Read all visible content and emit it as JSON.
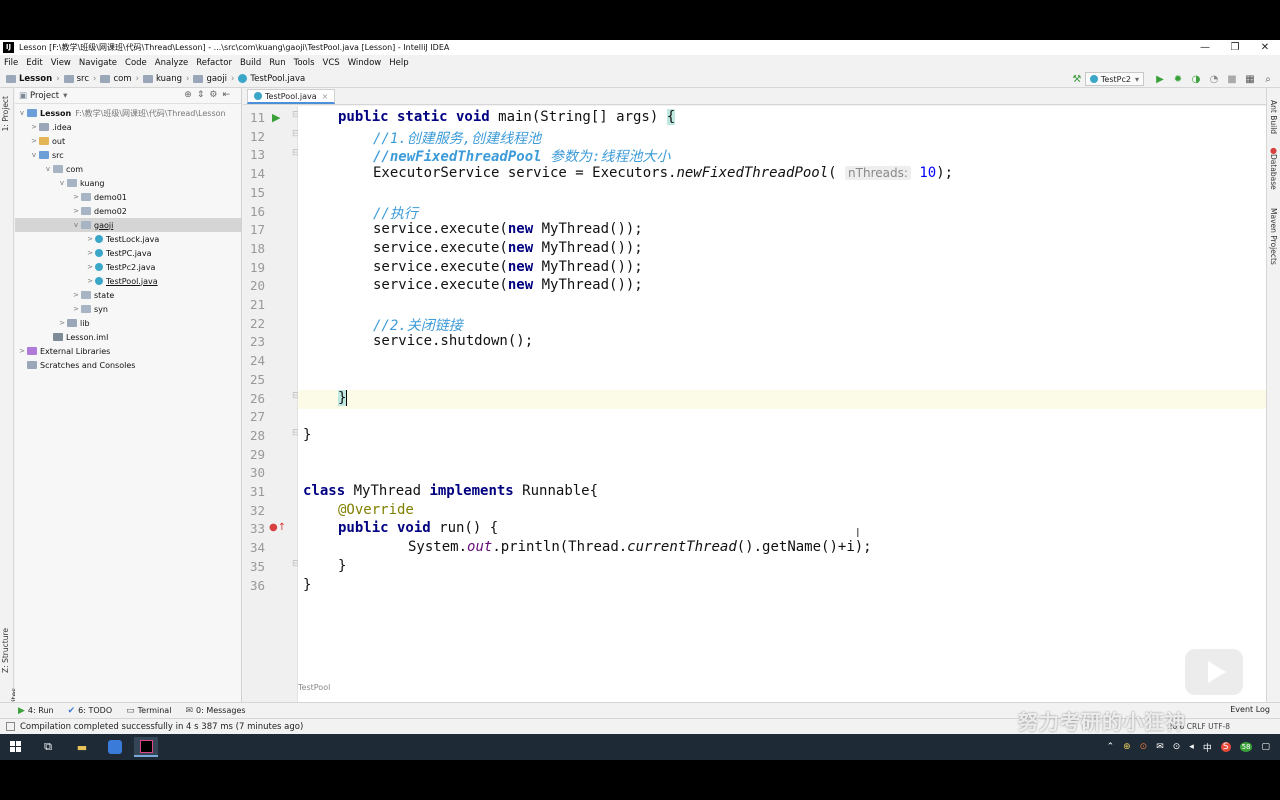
{
  "window": {
    "title": "Lesson [F:\\教学\\班级\\网课班\\代码\\Thread\\Lesson] - ...\\src\\com\\kuang\\gaoji\\TestPool.java [Lesson] - IntelliJ IDEA",
    "controls": [
      "—",
      "❐",
      "✕"
    ]
  },
  "menu": [
    "File",
    "Edit",
    "View",
    "Navigate",
    "Code",
    "Analyze",
    "Refactor",
    "Build",
    "Run",
    "Tools",
    "VCS",
    "Window",
    "Help"
  ],
  "breadcrumbs": [
    "Lesson",
    "src",
    "com",
    "kuang",
    "gaoji",
    "TestPool.java"
  ],
  "run_config": "TestPc2",
  "left_tabs": {
    "project": "1: Project",
    "structure": "Z: Structure",
    "favorites": "2: Favorites"
  },
  "project_panel": {
    "title": "Project",
    "tree": [
      {
        "label": "Lesson",
        "path": "F:\\教学\\班级\\网课班\\代码\\Thread\\Lesson",
        "arrow": "v"
      },
      {
        "label": ".idea",
        "arrow": ">"
      },
      {
        "label": "out",
        "arrow": ">"
      },
      {
        "label": "src",
        "arrow": "v"
      },
      {
        "label": "com",
        "arrow": "v"
      },
      {
        "label": "kuang",
        "arrow": "v"
      },
      {
        "label": "demo01",
        "arrow": ">"
      },
      {
        "label": "demo02",
        "arrow": ">"
      },
      {
        "label": "gaoji",
        "arrow": "v"
      },
      {
        "label": "TestLock.java",
        "arrow": ">"
      },
      {
        "label": "TestPC.java",
        "arrow": ">"
      },
      {
        "label": "TestPc2.java",
        "arrow": ">"
      },
      {
        "label": "TestPool.java",
        "arrow": ">"
      },
      {
        "label": "state",
        "arrow": ">"
      },
      {
        "label": "syn",
        "arrow": ">"
      },
      {
        "label": "lib",
        "arrow": ">"
      },
      {
        "label": "Lesson.iml",
        "arrow": ""
      },
      {
        "label": "External Libraries",
        "arrow": ">"
      },
      {
        "label": "Scratches and Consoles",
        "arrow": ""
      }
    ]
  },
  "editor": {
    "tab_label": "TestPool.java",
    "tab_close": "×",
    "footer_label": "TestPool",
    "line_numbers": [
      "11",
      "12",
      "13",
      "14",
      "15",
      "16",
      "17",
      "18",
      "19",
      "20",
      "21",
      "22",
      "23",
      "24",
      "25",
      "26",
      "27",
      "28",
      "29",
      "30",
      "31",
      "32",
      "33",
      "34",
      "35",
      "36"
    ],
    "code": {
      "l11_kw": "public static void",
      "l11_rest": " main(String[] args) ",
      "l11_brace": "{",
      "l12": "//1.创建服务,创建线程池",
      "l13a": "//newFixedThreadPool",
      "l13b": " 参数为:线程池大小",
      "l14a": "ExecutorService service = Executors.",
      "l14b": "newFixedThreadPool",
      "l14c": "(",
      "l14hint": "nThreads:",
      "l14num": "10",
      "l14d": ");",
      "l16": "//执行",
      "exec_a": "service.execute(",
      "exec_kw": "new",
      "exec_b": " MyThread());",
      "l22": "//2.关闭链接",
      "l23": "service.shutdown();",
      "l26": "}",
      "l28": "}",
      "l31_kw1": "class",
      "l31_a": " MyThread ",
      "l31_kw2": "implements",
      "l31_b": " Runnable{",
      "l32": "@Override",
      "l33_kw": "public void",
      "l33_b": " run() {",
      "l34_a": "System.",
      "l34_out": "out",
      "l34_b": ".println(Thread.",
      "l34_it": "currentThread",
      "l34_c": "().getName()+i);",
      "l35": "}",
      "l36": "}"
    }
  },
  "right_tabs": [
    "Ant Build",
    "Database",
    "Maven Projects"
  ],
  "bottom_tabs": [
    {
      "icon": "▶",
      "label": "4: Run"
    },
    {
      "icon": "✔",
      "label": "6: TODO"
    },
    {
      "icon": "▭",
      "label": "Terminal"
    },
    {
      "icon": "✉",
      "label": "0: Messages"
    }
  ],
  "event_log": "Event Log",
  "status": {
    "message": "Compilation completed successfully in 4 s 387 ms (7 minutes ago)",
    "right": "26:6   CRLF   UTF-8"
  },
  "taskbar": {
    "tray": [
      "⊕",
      "⊙",
      "✉",
      "⊙",
      "◂",
      "中",
      "S",
      "58"
    ]
  },
  "watermark": "努力考研的小狂神"
}
